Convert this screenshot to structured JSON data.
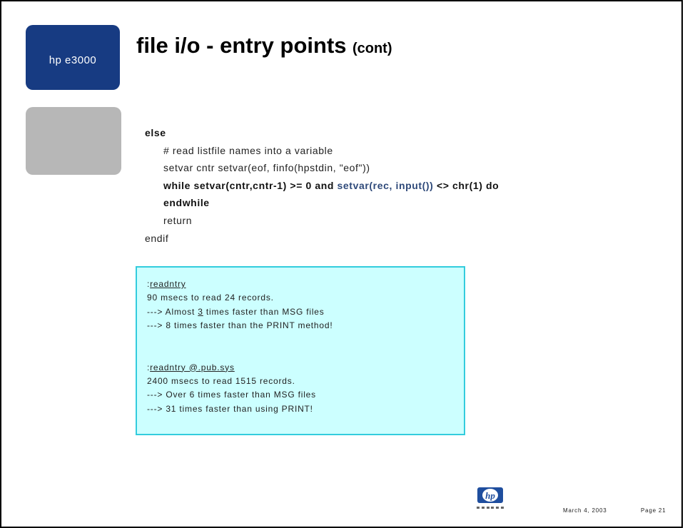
{
  "sidebar": {
    "brand_label": "hp e3000"
  },
  "title": {
    "main": "file i/o - entry points",
    "suffix": "(cont)"
  },
  "code": {
    "line1": "else",
    "line2": "# read listfile names into a variable",
    "line3": "setvar cntr setvar(eof, finfo(hpstdin, \"eof\"))",
    "line4_a": "while setvar(cntr,cntr-1) >= 0 and ",
    "line4_b": "setvar(rec, input())",
    "line4_c": " <> chr(1) do",
    "line5": "endwhile",
    "line6": "return",
    "line7": "endif"
  },
  "results": {
    "prompt1_colon": ":",
    "prompt1_cmd": "readntry",
    "result1": "90 msecs to read 24 records.",
    "r1_arrow": "--->",
    "r1_a": " Almost ",
    "r1_num": "3",
    "r1_b": " times faster than MSG files",
    "r2_arrow": "--->",
    "r2_text": " 8 times faster than the PRINT method!",
    "prompt2_colon": ":",
    "prompt2_cmd": "readntry @.pub.sys",
    "result2": "2400 msecs to read 1515 records.",
    "r3_arrow": "--->",
    "r3_text": " Over 6 times faster than MSG files",
    "r4_arrow": "--->",
    "r4_text": " 31 times faster than using PRINT!"
  },
  "footer": {
    "logo_text": "hp",
    "date": "March 4, 2003",
    "page": "Page 21"
  },
  "colors": {
    "brand_blue": "#173b82",
    "box_fill": "#ccffff",
    "box_border": "#33ccdd",
    "code_highlight": "#2f4a7a"
  }
}
